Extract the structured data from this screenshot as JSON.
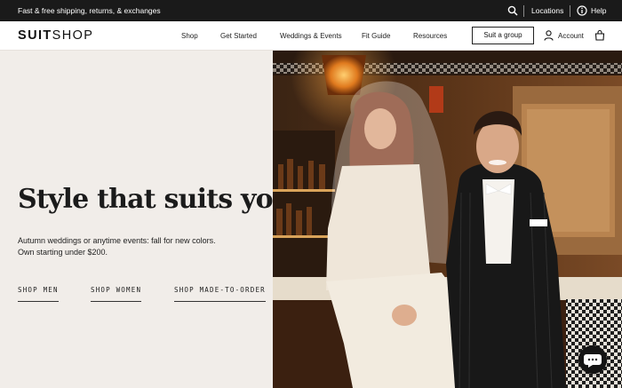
{
  "topbar": {
    "promo": "Fast & free shipping, returns, & exchanges",
    "locations": "Locations",
    "help": "Help"
  },
  "nav": {
    "logo_bold": "SUIT",
    "logo_light": "SHOP",
    "links": [
      "Shop",
      "Get Started",
      "Weddings & Events",
      "Fit Guide",
      "Resources"
    ],
    "suit_group": "Suit a group",
    "account": "Account"
  },
  "hero": {
    "headline": "Style that suits you",
    "sub_line1": "Autumn weddings or anytime events: fall for new colors.",
    "sub_line2": "Own starting under $200.",
    "cta": [
      "SHOP MEN",
      "SHOP WOMEN",
      "SHOP MADE-TO-ORDER"
    ]
  },
  "icons": {
    "search": "search-icon",
    "help": "help-circle-icon",
    "account": "person-icon",
    "bag": "shopping-bag-icon",
    "chat": "chat-bubble-icon"
  },
  "colors": {
    "topbar_bg": "#1a1a1a",
    "hero_bg": "#f1ede9",
    "text": "#1b1b1b"
  }
}
